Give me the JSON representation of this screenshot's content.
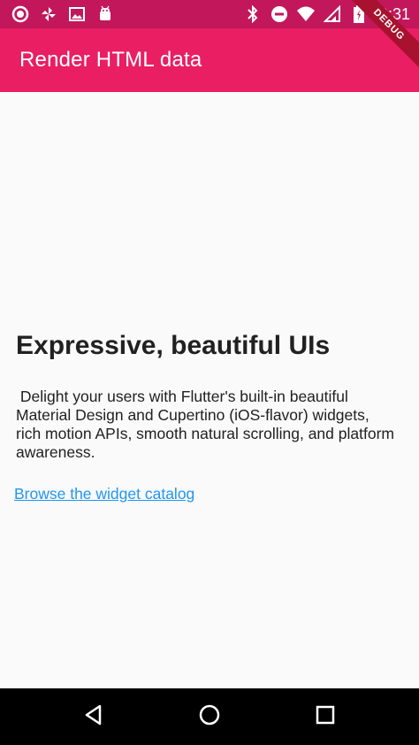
{
  "status_bar": {
    "time": "9:31",
    "left_icons": [
      "circle-icon",
      "pinwheel-icon",
      "image-icon",
      "android-icon"
    ],
    "right_icons": [
      "bluetooth-icon",
      "do-not-disturb-icon",
      "wifi-icon",
      "signal-icon",
      "battery-icon"
    ]
  },
  "app_bar": {
    "title": "Render HTML data",
    "debug_label": "DEBUG",
    "color": "#e91e63"
  },
  "content": {
    "headline": "Expressive, beautiful UIs",
    "body": " Delight your users with Flutter's built-in beautiful Material Design and Cupertino (iOS-flavor) widgets, rich motion APIs, smooth natural scrolling, and platform awareness.",
    "link": "Browse the widget catalog",
    "link_color": "#2196f3"
  },
  "nav_bar": {
    "buttons": [
      "back-icon",
      "home-icon",
      "recents-icon"
    ]
  }
}
